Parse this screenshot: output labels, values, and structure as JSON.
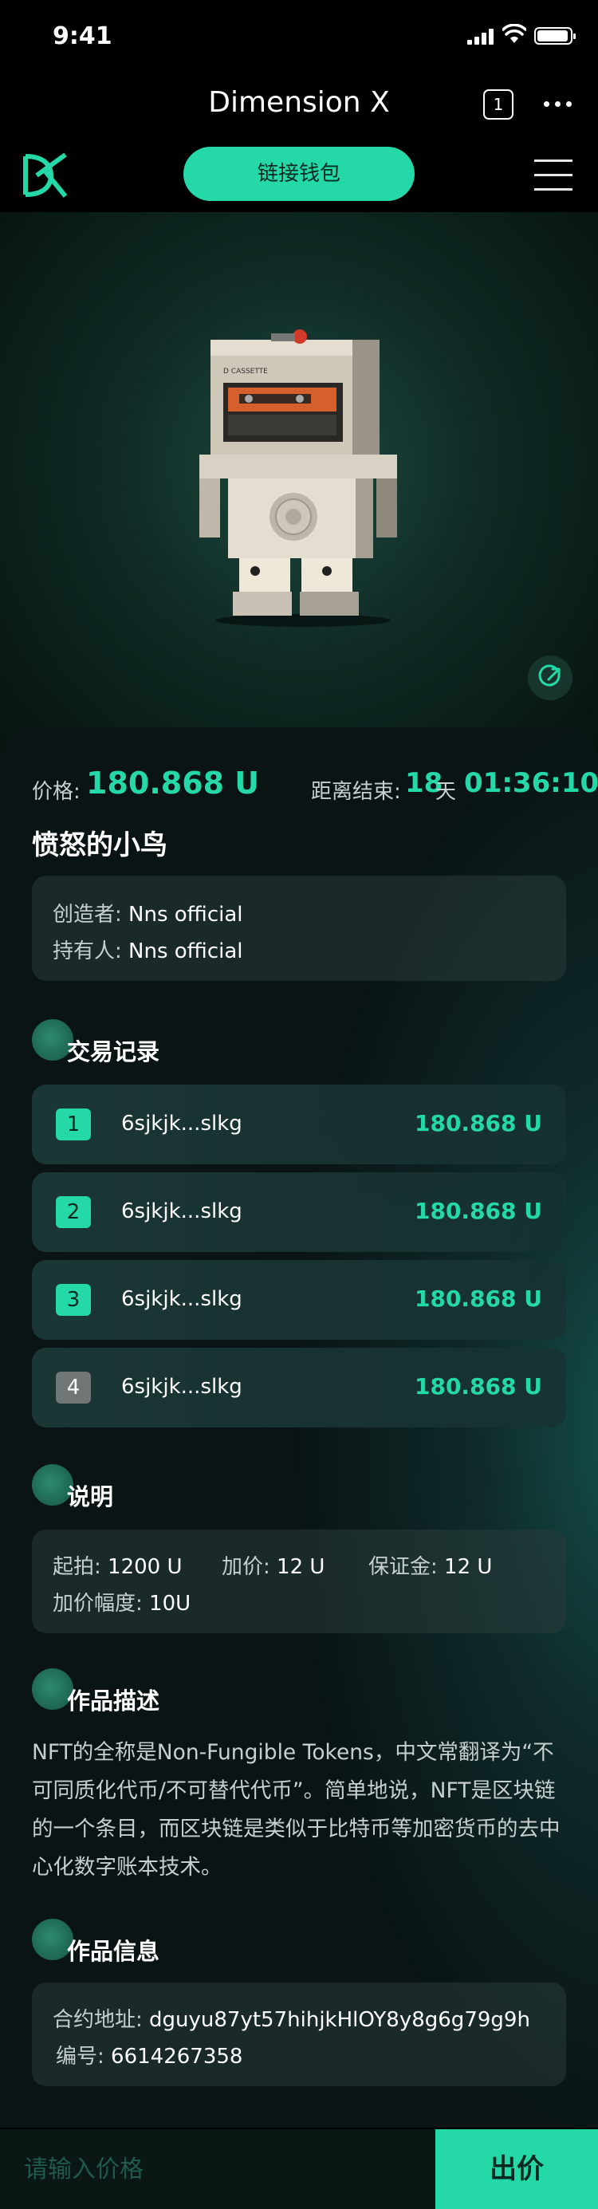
{
  "status_bar": {
    "time": "9:41"
  },
  "nav": {
    "title": "Dimension X",
    "tab_count": "1"
  },
  "header": {
    "connect_wallet": "链接钱包"
  },
  "item": {
    "price_label": "价格:",
    "price_value": "180.868 U",
    "countdown_label": "距离结束:",
    "countdown_days": "18",
    "countdown_days_unit": "天",
    "countdown_time": "01:36:10",
    "title": "愤怒的小鸟",
    "creator_label": "创造者:",
    "creator": "Nns official",
    "owner_label": "持有人:",
    "owner": "Nns official"
  },
  "records": {
    "title": "交易记录",
    "items": [
      {
        "rank": "1",
        "address": "6sjkjk...slkg",
        "amount": "180.868 U"
      },
      {
        "rank": "2",
        "address": "6sjkjk...slkg",
        "amount": "180.868 U"
      },
      {
        "rank": "3",
        "address": "6sjkjk...slkg",
        "amount": "180.868 U"
      },
      {
        "rank": "4",
        "address": "6sjkjk...slkg",
        "amount": "180.868 U"
      }
    ]
  },
  "rules": {
    "title": "说明",
    "start_label": "起拍:",
    "start_value": "1200 U",
    "increment_label": "加价:",
    "increment_value": "12 U",
    "deposit_label": "保证金:",
    "deposit_value": "12 U",
    "range_label": "加价幅度:",
    "range_value": "10U"
  },
  "description": {
    "title": "作品描述",
    "text": "NFT的全称是Non-Fungible Tokens，中文常翻译为“不可同质化代币/不可替代代币”。简单地说，NFT是区块链的一个条目，而区块链是类似于比特币等加密货币的去中心化数字账本技术。"
  },
  "info": {
    "title": "作品信息",
    "contract_label": "合约地址:",
    "contract_value": "dguyu87yt57hihjkHlOY8y8g6g79g9h",
    "number_label": "编号:",
    "number_value": "6614267358"
  },
  "bottom": {
    "placeholder": "请输入价格",
    "bid_label": "出价"
  },
  "colors": {
    "accent": "#25d8a8",
    "background": "#000000",
    "card": "#1c3a38"
  },
  "icons": [
    "signal-icon",
    "wifi-icon",
    "battery-icon",
    "tabs-icon",
    "more-icon",
    "logo-icon",
    "menu-icon",
    "share-icon"
  ]
}
